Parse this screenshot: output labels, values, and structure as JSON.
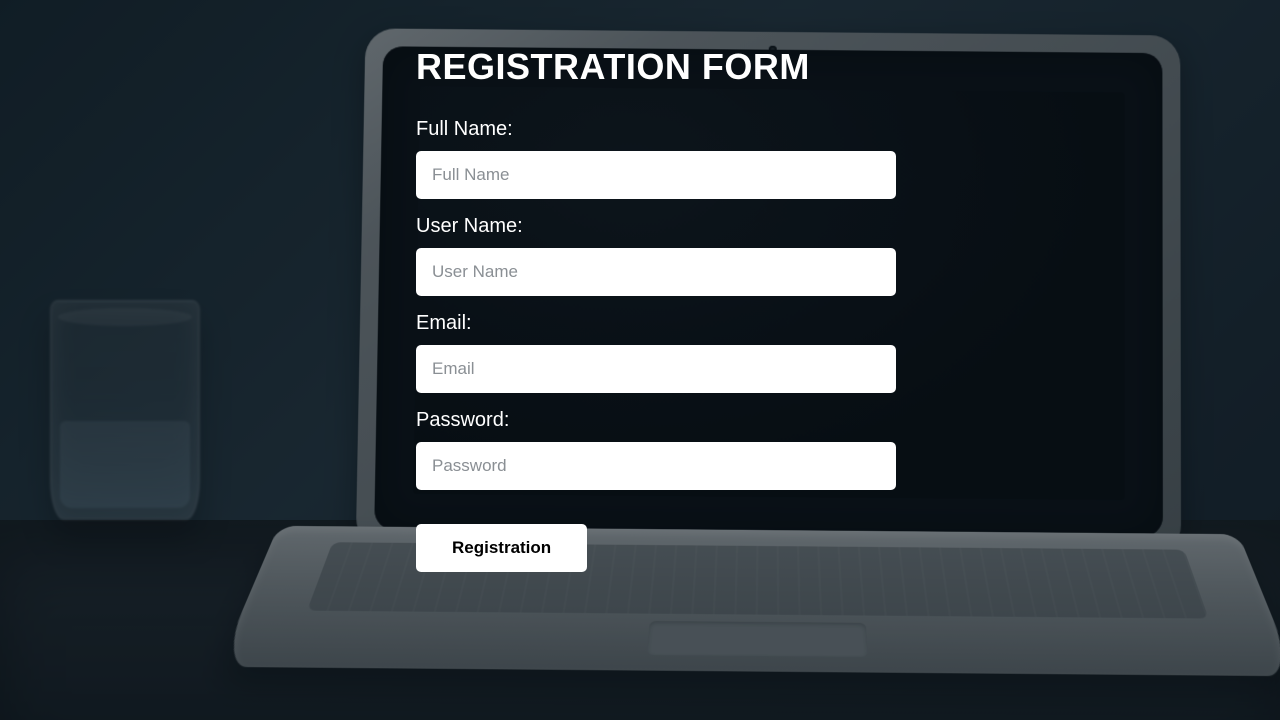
{
  "form": {
    "title": "REGISTRATION FORM",
    "fields": {
      "full_name": {
        "label": "Full Name:",
        "placeholder": "Full Name",
        "value": ""
      },
      "user_name": {
        "label": "User Name:",
        "placeholder": "User Name",
        "value": ""
      },
      "email": {
        "label": "Email:",
        "placeholder": "Email",
        "value": ""
      },
      "password": {
        "label": "Password:",
        "placeholder": "Password",
        "value": ""
      }
    },
    "submit_label": "Registration"
  },
  "colors": {
    "text": "#ffffff",
    "input_bg": "#ffffff",
    "button_bg": "#ffffff",
    "button_text": "#000000",
    "placeholder": "#8a8f94"
  }
}
